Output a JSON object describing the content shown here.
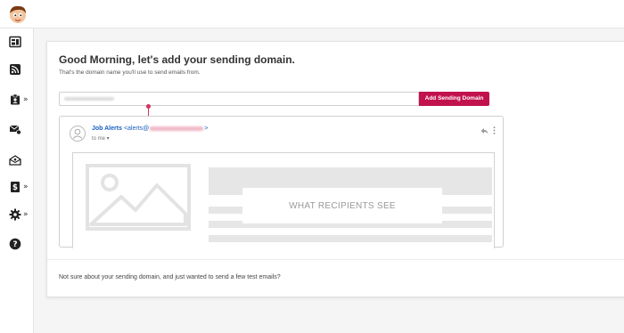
{
  "header": {
    "logo_icon": "mascot-avatar-icon"
  },
  "sidebar": {
    "items": [
      {
        "icon": "dashboard-icon",
        "has_submenu": false
      },
      {
        "icon": "rss-icon",
        "has_submenu": false
      },
      {
        "icon": "jobs-icon",
        "has_submenu": true
      },
      {
        "icon": "email-settings-icon",
        "has_submenu": false
      },
      {
        "icon": "mail-campaign-icon",
        "has_submenu": false
      },
      {
        "icon": "billing-icon",
        "has_submenu": true
      },
      {
        "icon": "settings-gear-icon",
        "has_submenu": true
      },
      {
        "icon": "help-icon",
        "has_submenu": false
      }
    ],
    "submenu_glyph": "»"
  },
  "main": {
    "title": "Good Morning, let's add your sending domain.",
    "subtitle": "That's the domain name you'll use to send emails from.",
    "domain_input": {
      "value": "",
      "placeholder": ""
    },
    "add_button_label": "Add Sending Domain",
    "preview": {
      "sender_name": "Job Alerts",
      "email_open": "<alerts@",
      "email_close": ">",
      "to_line": "to me ▾",
      "placeholder_label": "WHAT RECIPIENTS SEE"
    },
    "footer_text": "Not sure about your sending domain, and just wanted to send a few test emails?"
  },
  "colors": {
    "accent": "#c2124e",
    "link": "#1a5fbf",
    "connector": "#d6335e"
  }
}
